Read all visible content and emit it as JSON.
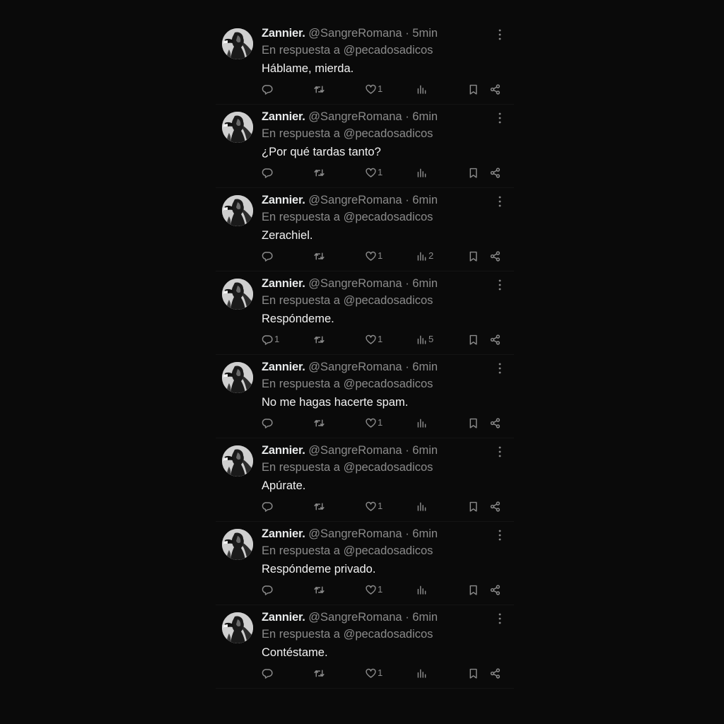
{
  "colors": {
    "background": "#0a0a0a",
    "name": "#e7e9ea",
    "secondary": "#8b8b8b",
    "text": "#f2f2f2"
  },
  "tweets": [
    {
      "name": "Zannier.",
      "handle": "@SangreRomana",
      "sep": "·",
      "time": "5min",
      "reply_to": "En respuesta a @pecadosadicos",
      "text": "Háblame, mierda.",
      "replies": "",
      "likes": "1",
      "views": ""
    },
    {
      "name": "Zannier.",
      "handle": "@SangreRomana",
      "sep": "·",
      "time": "6min",
      "reply_to": "En respuesta a @pecadosadicos",
      "text": "¿Por qué tardas tanto?",
      "replies": "",
      "likes": "1",
      "views": ""
    },
    {
      "name": "Zannier.",
      "handle": "@SangreRomana",
      "sep": "·",
      "time": "6min",
      "reply_to": "En respuesta a @pecadosadicos",
      "text": "Zerachiel.",
      "replies": "",
      "likes": "1",
      "views": "2"
    },
    {
      "name": "Zannier.",
      "handle": "@SangreRomana",
      "sep": "·",
      "time": "6min",
      "reply_to": "En respuesta a @pecadosadicos",
      "text": "Respóndeme.",
      "replies": "1",
      "likes": "1",
      "views": "5"
    },
    {
      "name": "Zannier.",
      "handle": "@SangreRomana",
      "sep": "·",
      "time": "6min",
      "reply_to": "En respuesta a @pecadosadicos",
      "text": "No me hagas hacerte spam.",
      "replies": "",
      "likes": "1",
      "views": ""
    },
    {
      "name": "Zannier.",
      "handle": "@SangreRomana",
      "sep": "·",
      "time": "6min",
      "reply_to": "En respuesta a @pecadosadicos",
      "text": "Apúrate.",
      "replies": "",
      "likes": "1",
      "views": ""
    },
    {
      "name": "Zannier.",
      "handle": "@SangreRomana",
      "sep": "·",
      "time": "6min",
      "reply_to": "En respuesta a @pecadosadicos",
      "text": "Respóndeme privado.",
      "replies": "",
      "likes": "1",
      "views": ""
    },
    {
      "name": "Zannier.",
      "handle": "@SangreRomana",
      "sep": "·",
      "time": "6min",
      "reply_to": "En respuesta a @pecadosadicos",
      "text": "Contéstame.",
      "replies": "",
      "likes": "1",
      "views": ""
    }
  ],
  "icons": {
    "avatar": "profile-photo",
    "more": "more-vertical-icon",
    "reply": "reply-icon",
    "retweet": "retweet-icon",
    "like": "heart-icon",
    "views": "views-icon",
    "bookmark": "bookmark-icon",
    "share": "share-icon"
  }
}
